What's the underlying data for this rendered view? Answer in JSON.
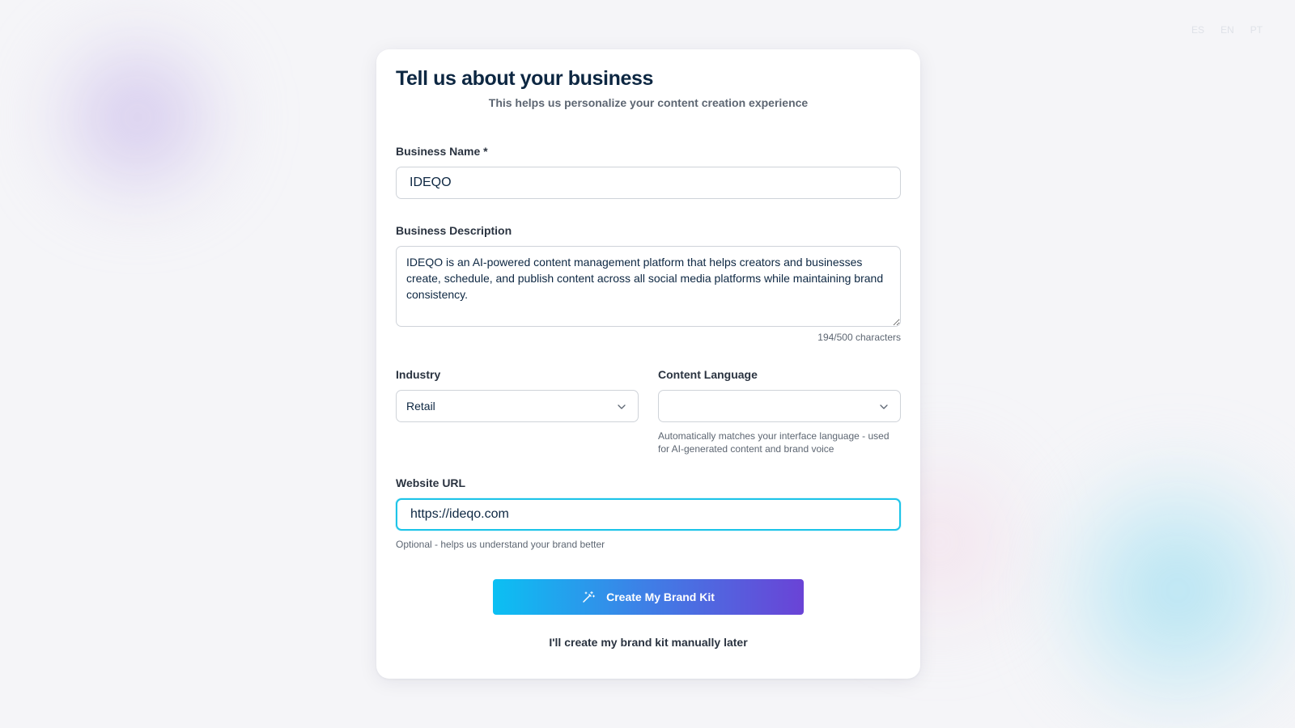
{
  "language_switcher": [
    "ES",
    "EN",
    "PT"
  ],
  "form": {
    "title": "Tell us about your business",
    "subtitle": "This helps us personalize your content creation experience",
    "business_name": {
      "label": "Business Name *",
      "value": "IDEQO"
    },
    "business_description": {
      "label": "Business Description",
      "value": "IDEQO is an AI-powered content management platform that helps creators and businesses create, schedule, and publish content across all social media platforms while maintaining brand consistency.",
      "char_count": "194/500 characters"
    },
    "industry": {
      "label": "Industry",
      "selected": "Retail"
    },
    "content_language": {
      "label": "Content Language",
      "selected": "",
      "help": "Automatically matches your interface language - used for AI-generated content and brand voice"
    },
    "website_url": {
      "label": "Website URL",
      "value": "https://ideqo.com",
      "help": "Optional - helps us understand your brand better"
    },
    "primary_button": {
      "label": "Create My Brand Kit",
      "icon": "magic-wand-icon"
    },
    "secondary_link": "I'll create my brand kit manually later"
  },
  "colors": {
    "background": "#f5f5f8",
    "title": "#0d2742",
    "focus_border": "#1dc4e8",
    "button_gradient_start": "#0bc0f3",
    "button_gradient_end": "#6a43d6"
  }
}
